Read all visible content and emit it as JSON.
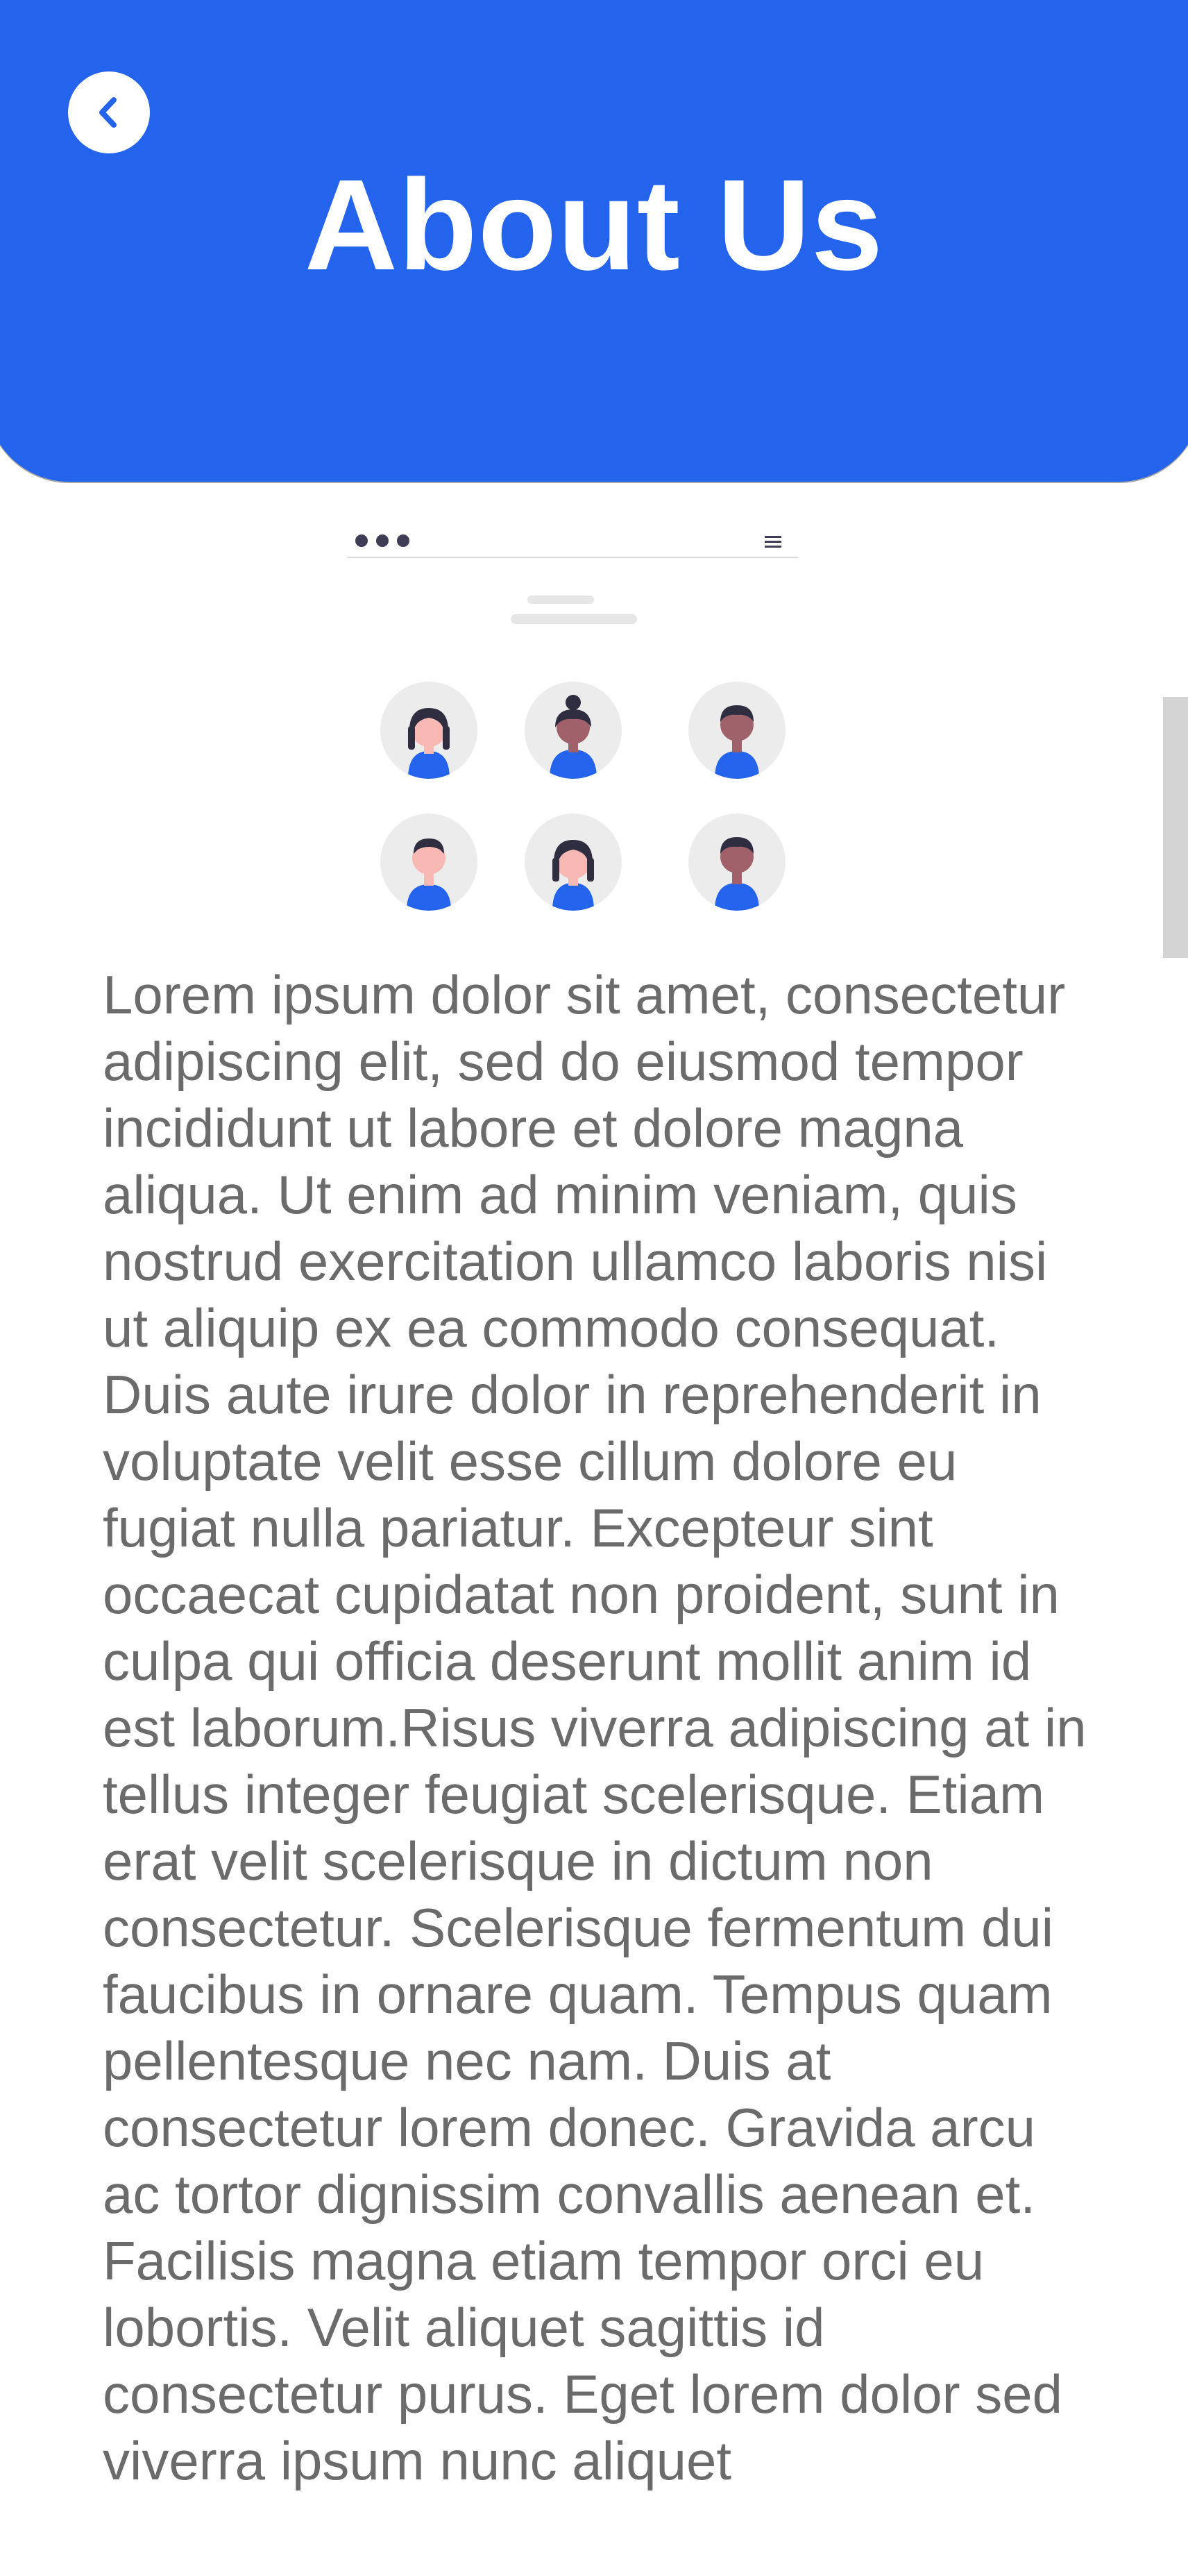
{
  "header": {
    "title": "About Us",
    "back_icon": "chevron-left-icon",
    "background_color": "#2463EB"
  },
  "illustration": {
    "avatars": [
      {
        "name": "avatar-1",
        "skin": "#f8b9b5",
        "hair": "#2f2e41"
      },
      {
        "name": "avatar-2",
        "skin": "#a0616a",
        "hair": "#2f2e41"
      },
      {
        "name": "avatar-3",
        "skin": "#9f616a",
        "hair": "#2f2e41"
      },
      {
        "name": "avatar-4",
        "skin": "#f8b9b5",
        "hair": "#2f2e41"
      },
      {
        "name": "avatar-5",
        "skin": "#f8b9b5",
        "hair": "#2f2e41"
      },
      {
        "name": "avatar-6",
        "skin": "#a0616a",
        "hair": "#2f2e41"
      }
    ],
    "accent_color": "#2463EB"
  },
  "content": {
    "paragraph": "Lorem ipsum dolor sit amet, consectetur adipiscing elit, sed do eiusmod tempor incididunt ut labore et dolore magna aliqua. Ut enim ad minim veniam, quis nostrud exercitation ullamco laboris nisi ut aliquip ex ea commodo consequat. Duis aute irure dolor in reprehenderit in voluptate velit esse cillum dolore eu fugiat nulla pariatur. Excepteur sint occaecat cupidatat non proident, sunt in culpa qui officia deserunt mollit anim id est laborum.Risus viverra adipiscing at in tellus integer feugiat scelerisque. Etiam erat velit scelerisque in dictum non consectetur. Scelerisque fermentum dui faucibus in ornare quam. Tempus quam pellentesque nec nam. Duis at consectetur lorem donec. Gravida arcu ac tortor dignissim convallis aenean et. Facilisis magna etiam tempor orci eu lobortis. Velit aliquet sagittis id consectetur purus. Eget lorem dolor sed viverra ipsum nunc aliquet"
  }
}
